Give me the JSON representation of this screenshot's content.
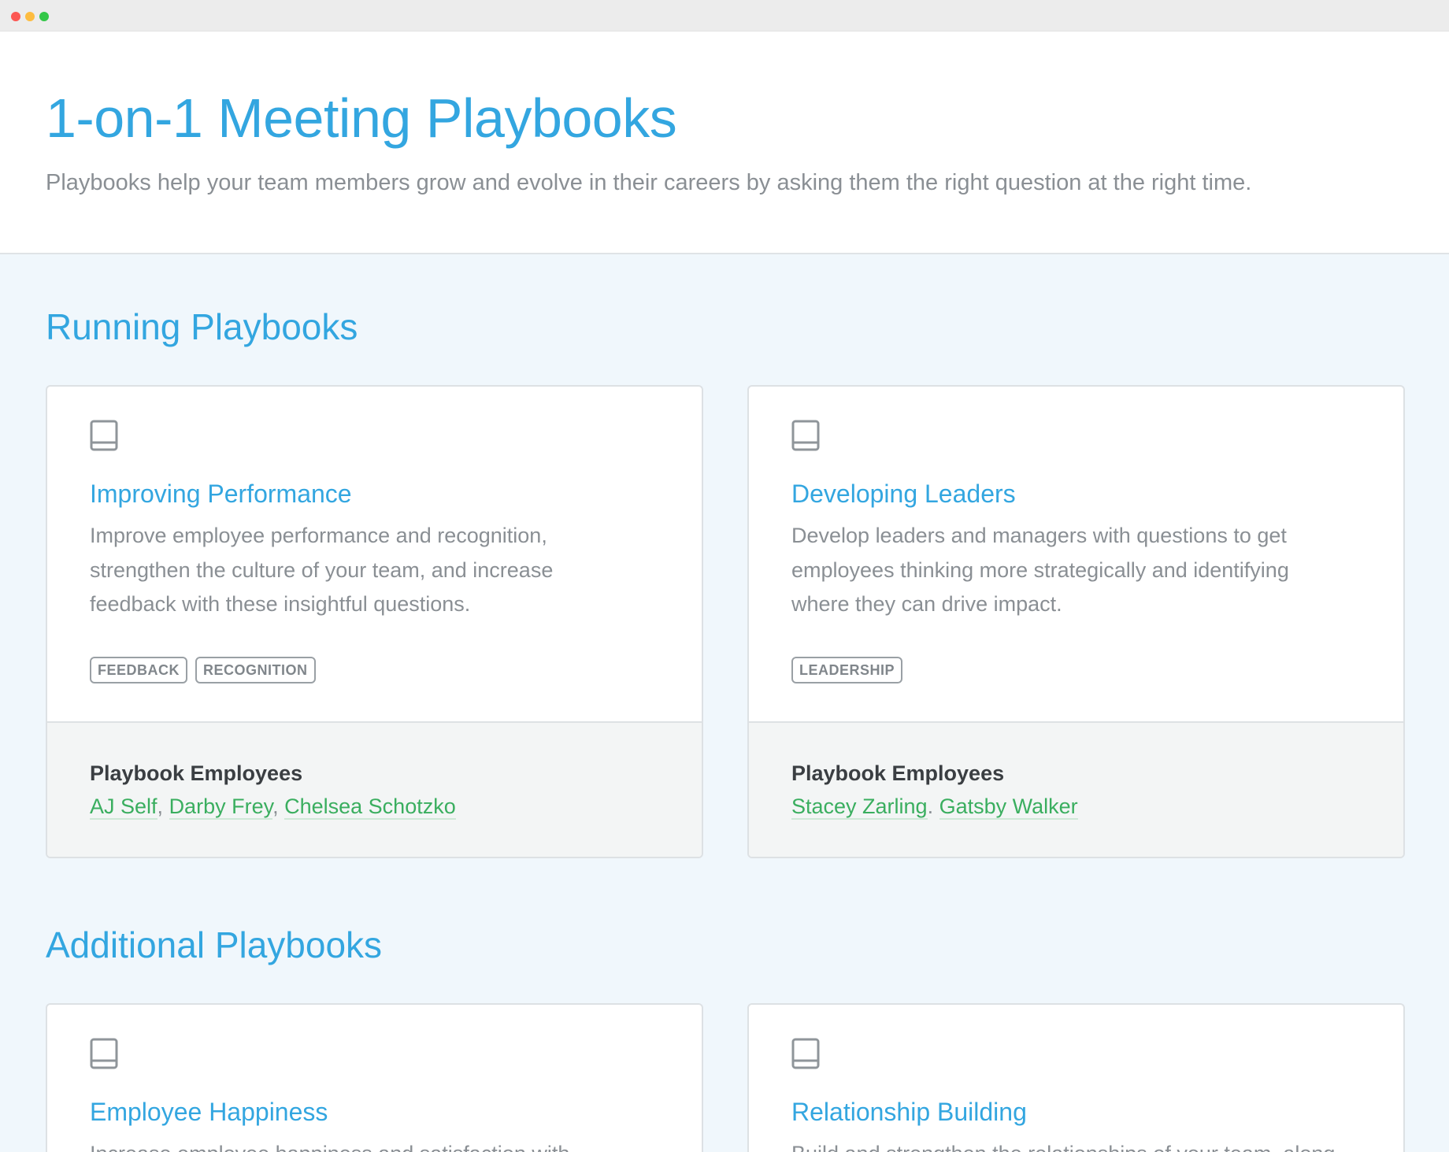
{
  "page": {
    "title": "1-on-1 Meeting Playbooks",
    "subtitle": "Playbooks help your team members grow and evolve in their careers by asking them the right question at the right time."
  },
  "running": {
    "title": "Running Playbooks",
    "footer_label": "Playbook Employees",
    "cards": [
      {
        "title": "Improving Performance",
        "desc_lines": [
          "Improve employee performance and recognition,",
          "strengthen the culture of your team, and increase",
          "feedback with these insightful questions."
        ],
        "tags": [
          "FEEDBACK",
          "RECOGNITION"
        ],
        "employees": [
          "AJ Self",
          "Darby Frey",
          "Chelsea Schotzko"
        ]
      },
      {
        "title": "Developing Leaders",
        "desc_lines": [
          "Develop leaders and managers with questions to get",
          "employees thinking more strategically and identifying",
          "where they can drive impact."
        ],
        "tags": [
          "LEADERSHIP"
        ],
        "employees": [
          "Stacey Zarling",
          "Gatsby Walker"
        ]
      }
    ]
  },
  "additional": {
    "title": "Additional Playbooks",
    "cards": [
      {
        "title": "Employee Happiness",
        "desc_lines": [
          "Increase employee happiness and satisfaction with"
        ]
      },
      {
        "title": "Relationship Building",
        "desc_lines": [
          "Build and strengthen the relationships of your team, along"
        ]
      }
    ]
  },
  "icons": {
    "book": "book-icon"
  },
  "colors": {
    "accent": "#33a6e0",
    "link_green": "#3aae5f",
    "background": "#f0f7fc"
  }
}
